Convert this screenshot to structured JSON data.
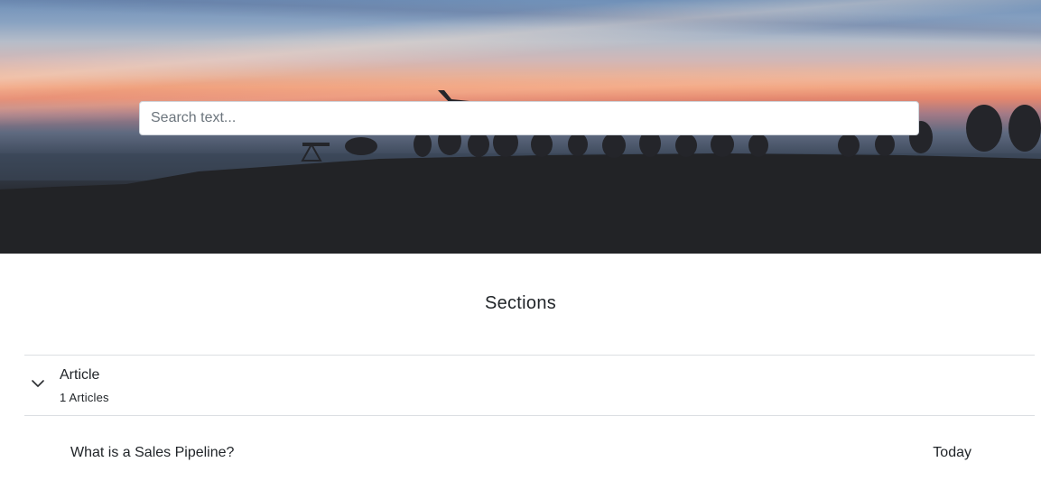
{
  "hero": {
    "search": {
      "placeholder": "Search text..."
    }
  },
  "sections": {
    "title": "Sections",
    "items": [
      {
        "name": "Article",
        "count_label": "1 Articles",
        "expanded": true,
        "articles": [
          {
            "title": "What is a Sales Pipeline?",
            "date": "Today"
          }
        ]
      }
    ]
  },
  "icons": {
    "expand": "chevron-down-icon"
  }
}
